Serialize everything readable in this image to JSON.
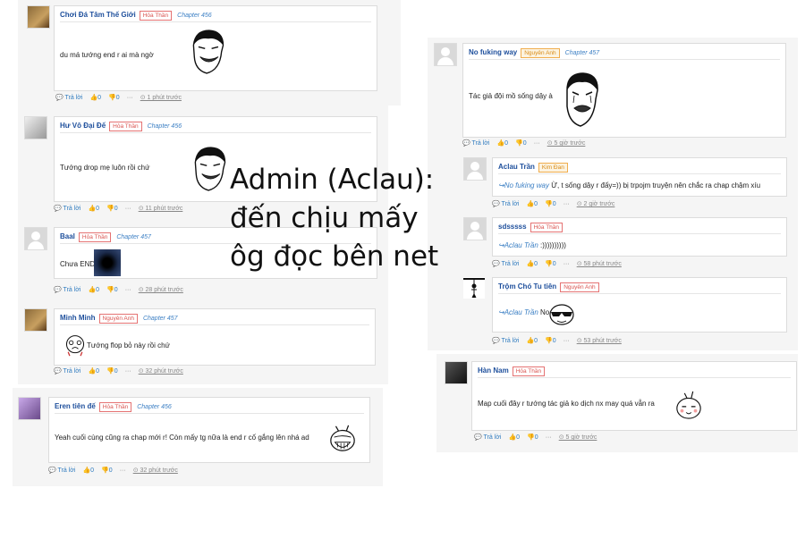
{
  "overlay_caption": [
    "Admin (Aclau):",
    "đến chịu mấy",
    "ôg đọc bên net"
  ],
  "labels": {
    "reply": "Trả lời",
    "like": "0",
    "dislike": "0",
    "more": "···"
  },
  "colors": {
    "username": "#1e4f9c",
    "badge_red": "#d9534f",
    "badge_orange": "#d98c1a",
    "link": "#3b7fc4"
  },
  "comments": [
    {
      "user": "Chơi Đá Tâm Thế Giới",
      "badge": "Hỏa Thần",
      "chapter": "Chapter 456",
      "text": "du má tướng end r ai mà ngờ",
      "time": "1 phút trước"
    },
    {
      "user": "Hư Vô Đại Đế",
      "badge": "Hỏa Thần",
      "chapter": "Chapter 456",
      "text": "Tướng drop mẹ luôn rồi chứ",
      "time": "11 phút trước"
    },
    {
      "user": "Baal",
      "badge": "Hỏa Thần",
      "chapter": "Chapter 457",
      "text": "Chưa END",
      "time": "28 phút trước"
    },
    {
      "user": "Minh Minh",
      "badge": "Nguyên Anh",
      "chapter": "Chapter 457",
      "text": "Tướng flop bỏ này rồi chứ",
      "time": "32 phút trước"
    },
    {
      "user": "Eren tiên đế",
      "badge": "Hỏa Thần",
      "chapter": "Chapter 456",
      "text": "Yeah cuối cùng cũng ra chap mới r! Còn mấy tg nữa là end r cố gắng lên nhá ad",
      "time": "32 phút trước"
    },
    {
      "user": "No fuking way",
      "badge": "Nguyên Anh",
      "chapter": "Chapter 457",
      "text": "Tác giả đội mồ sống dậy à",
      "time": "5 giờ trước"
    },
    {
      "user": "Aclau Trần",
      "badge": "Kim Đan",
      "mention": "↪No fuking way",
      "text": "Ừ, t sống dậy r đấy=)) bị trpojm truyện nên chắc ra chap chậm xíu",
      "time": "2 giờ trước"
    },
    {
      "user": "sdsssss",
      "badge": "Hỏa Thần",
      "mention": "↪Aclau Trần",
      "text": ":))))))))))",
      "time": "58 phút trước"
    },
    {
      "user": "Trộm Chó Tu tiên",
      "badge": "Nguyên Anh",
      "mention": "↪Aclau Trần",
      "text": "No",
      "time": "53 phút trước"
    },
    {
      "user": "Hàn Nam",
      "badge": "Hỏa Thần",
      "text": "Map cuối đây r tướng tác giả ko dịch nx may quá vẫn ra",
      "time": "5 giờ trước"
    }
  ]
}
